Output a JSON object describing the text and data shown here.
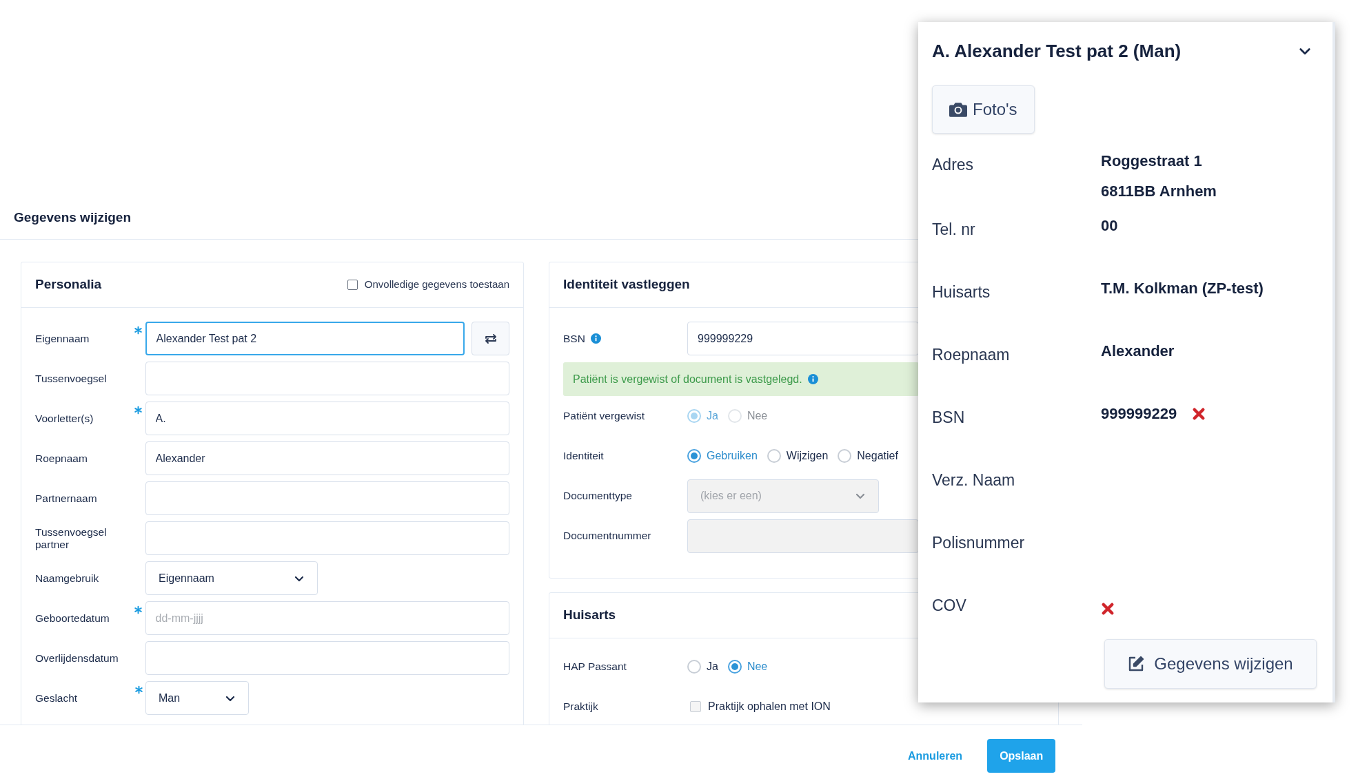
{
  "title": "Gegevens wijzigen",
  "personalia": {
    "heading": "Personalia",
    "allow_incomplete": {
      "label": "Onvolledige gegevens toestaan",
      "checked": false
    },
    "fields": [
      {
        "kind": "text_swap",
        "label": "Eigennaam",
        "required": true,
        "focused": true,
        "value": "Alexander Test pat 2"
      },
      {
        "kind": "text",
        "label": "Tussenvoegsel",
        "required": false,
        "focused": false
      },
      {
        "kind": "text",
        "label": "Voorletter(s)",
        "required": true,
        "focused": false,
        "value": "A."
      },
      {
        "kind": "text",
        "label": "Roepnaam",
        "required": false,
        "focused": false,
        "value": "Alexander"
      },
      {
        "kind": "text",
        "label": "Partnernaam",
        "required": false,
        "focused": false
      },
      {
        "kind": "text",
        "label": "Tussenvoegsel partner",
        "required": false,
        "focused": false
      },
      {
        "kind": "select",
        "label": "Naamgebruik",
        "required": false,
        "focused": false,
        "value": "Eigennaam"
      },
      {
        "kind": "text",
        "label": "Geboortedatum",
        "required": true,
        "focused": false,
        "placeholder": "dd-mm-jjjj"
      },
      {
        "kind": "text",
        "label": "Overlijdensdatum",
        "required": false,
        "focused": false
      },
      {
        "kind": "select",
        "label": "Geslacht",
        "required": true,
        "focused": false,
        "value": "Man"
      }
    ]
  },
  "identity": {
    "heading": "Identiteit vastleggen",
    "bsn": {
      "label": "BSN",
      "value": "999999229"
    },
    "alert": "Patiënt is vergewist of document is vastgelegd.",
    "rows": [
      {
        "kind": "radio",
        "label": "Patiënt vergewist",
        "disabled": true,
        "options": [
          {
            "label": "Ja",
            "selected": true
          },
          {
            "label": "Nee",
            "selected": false
          }
        ]
      },
      {
        "kind": "radio",
        "label": "Identiteit",
        "disabled": false,
        "options": [
          {
            "label": "Gebruiken",
            "selected": true
          },
          {
            "label": "Wijzigen",
            "selected": false
          },
          {
            "label": "Negatief",
            "selected": false
          }
        ]
      },
      {
        "kind": "select",
        "label": "Documenttype",
        "disabled": true,
        "placeholder": "(kies er een)"
      },
      {
        "kind": "text",
        "label": "Documentnummer",
        "disabled": true
      }
    ]
  },
  "huisarts": {
    "heading": "Huisarts",
    "rows": [
      {
        "kind": "radio",
        "label": "HAP Passant",
        "options": [
          {
            "label": "Ja",
            "selected": false
          },
          {
            "label": "Nee",
            "selected": true
          }
        ]
      },
      {
        "kind": "checkbox",
        "label": "Praktijk",
        "option": {
          "label": "Praktijk ophalen met ION",
          "checked": false
        }
      }
    ]
  },
  "panel": {
    "title": "A. Alexander Test pat 2 (Man)",
    "photos_button": "Foto's",
    "rows": [
      {
        "label": "Adres",
        "values": [
          "Roggestraat 1",
          "6811BB Arnhem"
        ],
        "invalid": false
      },
      {
        "label": "Tel. nr",
        "values": [
          "00"
        ],
        "invalid": false
      },
      {
        "label": "Huisarts",
        "values": [
          "T.M. Kolkman (ZP-test)"
        ],
        "invalid": false
      },
      {
        "label": "Roepnaam",
        "values": [
          "Alexander"
        ],
        "invalid": false
      },
      {
        "label": "BSN",
        "values": [
          "999999229"
        ],
        "invalid": true
      },
      {
        "label": "Verz. Naam",
        "invalid": false
      },
      {
        "label": "Polisnummer",
        "invalid": false
      },
      {
        "label": "COV",
        "invalid": true
      }
    ],
    "edit_button": "Gegevens wijzigen"
  },
  "footer": {
    "cancel": "Annuleren",
    "save": "Opslaan"
  }
}
